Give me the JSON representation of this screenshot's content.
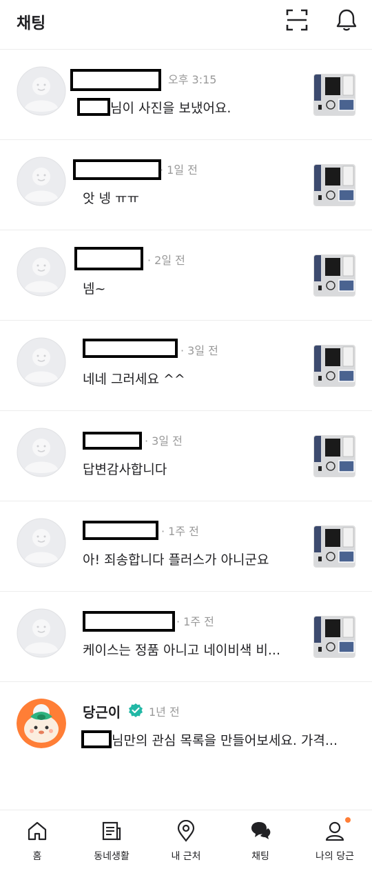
{
  "header": {
    "title": "채팅",
    "icons": [
      "scan-icon",
      "bell-icon"
    ],
    "notification_dot_color": "#ff7e36"
  },
  "chats": [
    {
      "time": "오후 3:15",
      "message": "님이 사진을 보냈어요."
    },
    {
      "time": "· 1일 전",
      "message": "앗 넹 ㅠㅠ"
    },
    {
      "time": "· 2일 전",
      "message": "넴~"
    },
    {
      "time": "· 3일 전",
      "message": "네네 그러세요 ^^"
    },
    {
      "time": "· 3일 전",
      "message": "답변감사합니다"
    },
    {
      "time": "· 1주 전",
      "message": "아! 죄송합니다 플러스가 아니군요"
    },
    {
      "time": "· 1주 전",
      "message": "케이스는 정품 아니고 네이비색 비..."
    },
    {
      "sender": "당근이",
      "time": "1년 전",
      "message": "님만의 관심 목록을 만들어보세요. 가격..."
    }
  ],
  "tabbar": {
    "items": [
      {
        "label": "홈",
        "icon": "home-icon"
      },
      {
        "label": "동네생활",
        "icon": "news-icon"
      },
      {
        "label": "내 근처",
        "icon": "location-pin-icon"
      },
      {
        "label": "채팅",
        "icon": "chat-bubbles-icon"
      },
      {
        "label": "나의 당근",
        "icon": "person-icon"
      }
    ]
  },
  "colors": {
    "brand_orange": "#ff7e36",
    "verified_green": "#22b8a6",
    "muted_text": "#999999"
  }
}
